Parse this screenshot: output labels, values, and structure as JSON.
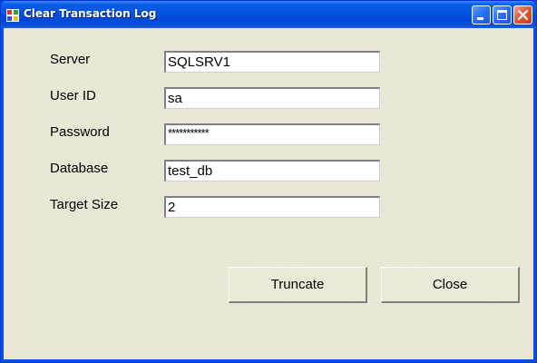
{
  "window": {
    "title": "Clear Transaction Log"
  },
  "form": {
    "server": {
      "label": "Server",
      "value": "SQLSRV1"
    },
    "user_id": {
      "label": "User ID",
      "value": "sa"
    },
    "password": {
      "label": "Password",
      "value": "***********"
    },
    "database": {
      "label": "Database",
      "value": "test_db"
    },
    "target_size": {
      "label": "Target Size",
      "value": "2"
    }
  },
  "buttons": {
    "truncate": "Truncate",
    "close": "Close"
  },
  "icons": {
    "app": "app-window-icon",
    "minimize": "minimize-icon",
    "maximize": "maximize-icon",
    "close": "close-icon"
  },
  "colors": {
    "titlebar": "#0054e3",
    "client_bg": "#ece9d8",
    "close_button": "#e45a3a"
  }
}
